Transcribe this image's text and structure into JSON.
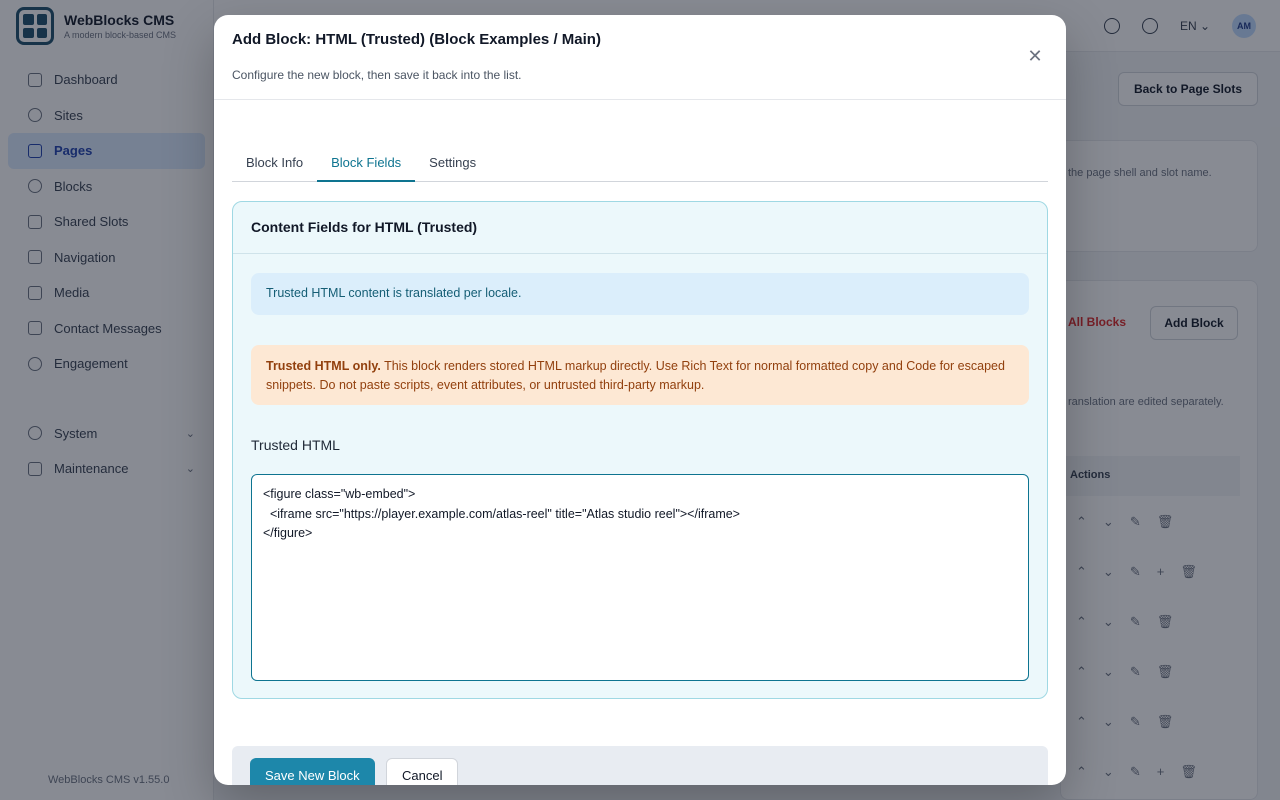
{
  "app": {
    "brand_title": "WebBlocks CMS",
    "brand_subtitle": "A modern block-based CMS",
    "version": "WebBlocks CMS v1.55.0",
    "nav": [
      {
        "label": "Dashboard",
        "icon": "grid-icon"
      },
      {
        "label": "Sites",
        "icon": "globe-icon"
      },
      {
        "label": "Pages",
        "icon": "page-icon",
        "active": true
      },
      {
        "label": "Blocks",
        "icon": "blocks-icon"
      },
      {
        "label": "Shared Slots",
        "icon": "layers-icon"
      },
      {
        "label": "Navigation",
        "icon": "menu-icon"
      },
      {
        "label": "Media",
        "icon": "image-icon"
      },
      {
        "label": "Contact Messages",
        "icon": "mail-icon"
      },
      {
        "label": "Engagement",
        "icon": "star-icon"
      }
    ],
    "nav_groups": [
      {
        "label": "System",
        "icon": "gear-icon"
      },
      {
        "label": "Maintenance",
        "icon": "file-icon"
      }
    ],
    "locale": "EN",
    "avatar_initials": "AM",
    "back_button": "Back to Page Slots",
    "bg_hint": "the page shell and slot name.",
    "bg_red_link": "All Blocks",
    "add_block_button": "Add Block",
    "bg_translation_note": "ranslation are edited separately.",
    "actions_header": "Actions"
  },
  "modal": {
    "title": "Add Block: HTML (Trusted) (Block Examples / Main)",
    "subtitle": "Configure the new block, then save it back into the list.",
    "tabs": [
      "Block Info",
      "Block Fields",
      "Settings"
    ],
    "active_tab": "Block Fields",
    "card_title": "Content Fields for HTML (Trusted)",
    "info_alert": "Trusted HTML content is translated per locale.",
    "warning_bold": "Trusted HTML only.",
    "warning_text": " This block renders stored HTML markup directly. Use Rich Text for normal formatted copy and Code for escaped snippets. Do not paste scripts, event attributes, or untrusted third-party markup.",
    "field_label": "Trusted HTML",
    "field_value": "<figure class=\"wb-embed\">\n  <iframe src=\"https://player.example.com/atlas-reel\" title=\"Atlas studio reel\"></iframe>\n</figure>",
    "save_button": "Save New Block",
    "cancel_button": "Cancel"
  }
}
